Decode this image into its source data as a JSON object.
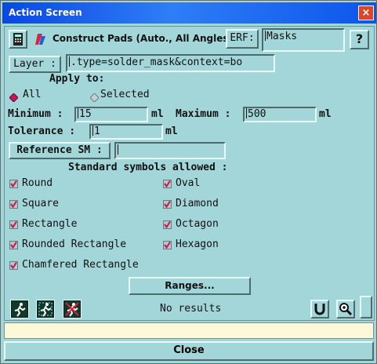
{
  "window": {
    "title": "Action Screen",
    "close_glyph": "×"
  },
  "header": {
    "title": "Construct Pads (Auto., All Angles)",
    "erf_label": "ERF:",
    "erf_value": "Masks",
    "help_label": "?"
  },
  "layer": {
    "label": "Layer :",
    "value": ".type=solder_mask&context=bo"
  },
  "apply_to": {
    "heading": "Apply to:",
    "options": [
      {
        "label": "All",
        "selected": true
      },
      {
        "label": "Selected",
        "selected": false
      }
    ]
  },
  "limits": {
    "minimum_label": "Minimum :",
    "minimum_value": "15",
    "minimum_unit": "ml",
    "maximum_label": "Maximum :",
    "maximum_value": "500",
    "maximum_unit": "ml",
    "tolerance_label": "Tolerance :",
    "tolerance_value": "1",
    "tolerance_unit": "ml"
  },
  "reference": {
    "label": "Reference SM :",
    "value": ""
  },
  "symbols": {
    "heading": "Standard symbols allowed :",
    "items": [
      {
        "label": "Round",
        "checked": true
      },
      {
        "label": "Oval",
        "checked": true
      },
      {
        "label": "Square",
        "checked": true
      },
      {
        "label": "Diamond",
        "checked": true
      },
      {
        "label": "Rectangle",
        "checked": true
      },
      {
        "label": "Octagon",
        "checked": true
      },
      {
        "label": "Rounded Rectangle",
        "checked": true
      },
      {
        "label": "Hexagon",
        "checked": true
      },
      {
        "label": "Chamfered Rectangle",
        "checked": true
      }
    ]
  },
  "ranges_label": "Ranges...",
  "results_text": "No results",
  "toolbar_icons": [
    "run-icon",
    "run-selected-icon",
    "stop-run-icon"
  ],
  "close_label": "Close",
  "colors": {
    "background": "#a3d6d9",
    "titlebar": "#0a48e0",
    "check": "#c0185a",
    "status": "#fdf8d8"
  }
}
